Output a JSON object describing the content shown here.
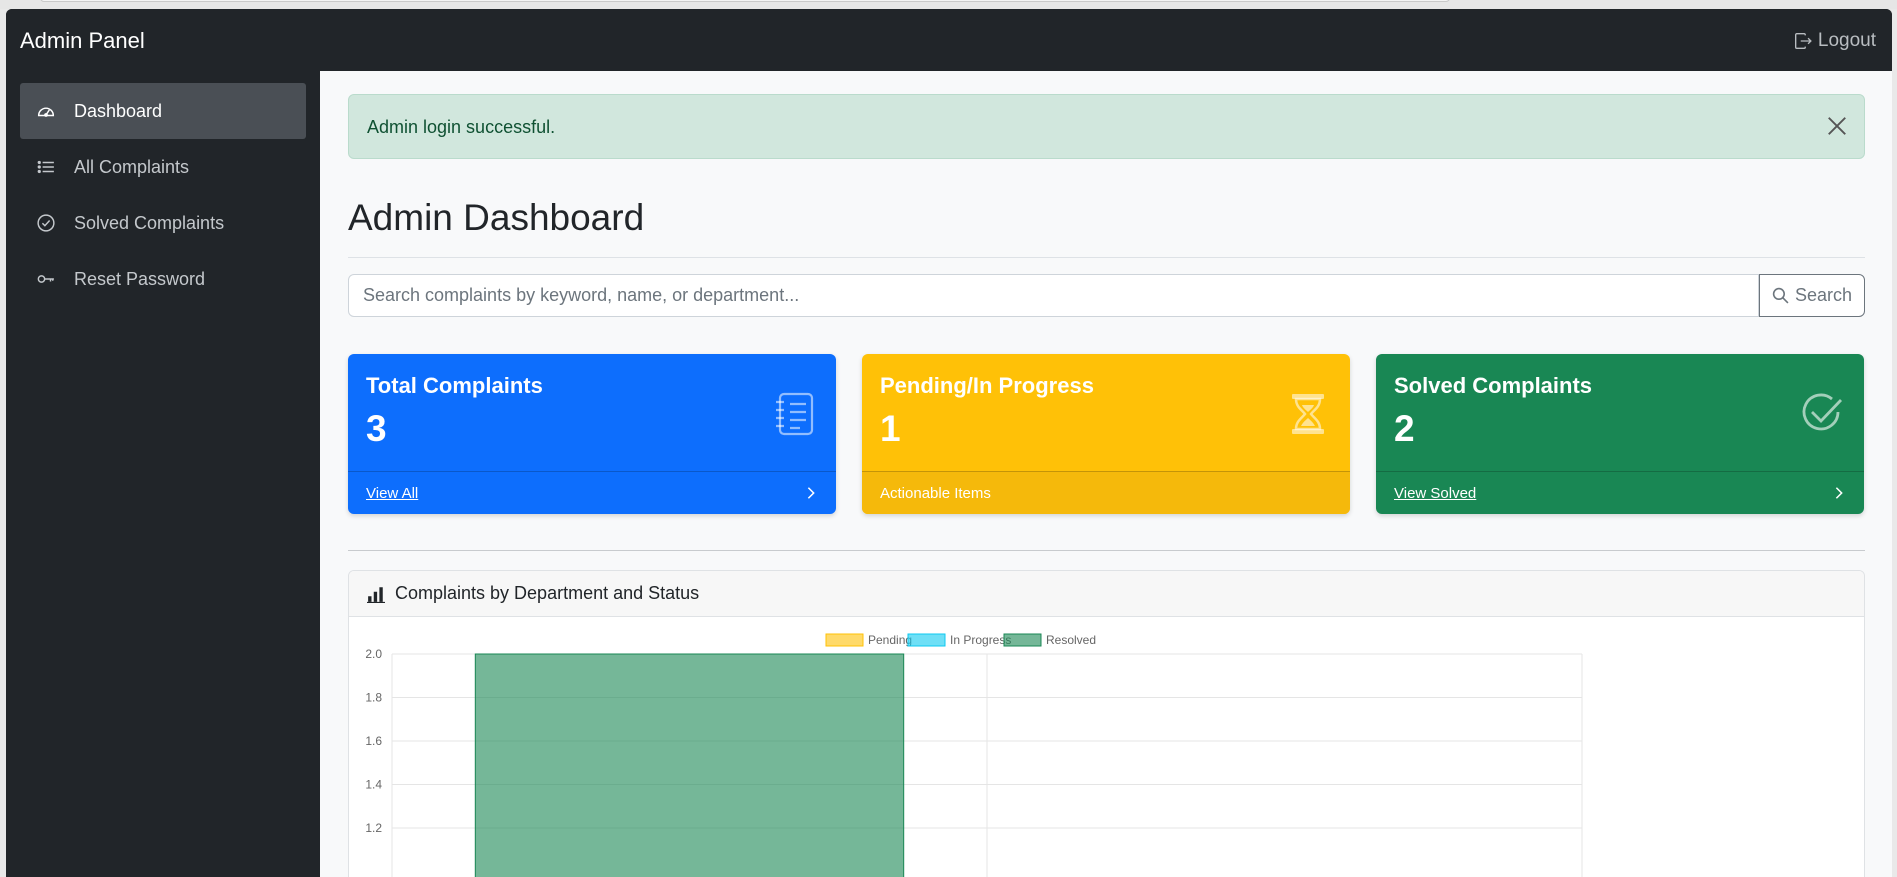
{
  "app": {
    "brand": "Admin Panel",
    "logout_label": "Logout"
  },
  "sidebar": {
    "items": [
      {
        "label": "Dashboard",
        "icon": "speedometer-icon",
        "active": true
      },
      {
        "label": "All Complaints",
        "icon": "list-icon",
        "active": false
      },
      {
        "label": "Solved Complaints",
        "icon": "check-circle-icon",
        "active": false
      },
      {
        "label": "Reset Password",
        "icon": "key-icon",
        "active": false
      }
    ]
  },
  "alert": {
    "message": "Admin login successful."
  },
  "page": {
    "title": "Admin Dashboard"
  },
  "search": {
    "placeholder": "Search complaints by keyword, name, or department...",
    "value": "",
    "button_label": "Search"
  },
  "cards": [
    {
      "title": "Total Complaints",
      "value": "3",
      "footer": "View All",
      "color": "#0d6efd",
      "icon": "journal-list-icon"
    },
    {
      "title": "Pending/In Progress",
      "value": "1",
      "footer": "Actionable Items",
      "color": "#ffc107",
      "icon": "hourglass-icon"
    },
    {
      "title": "Solved Complaints",
      "value": "2",
      "footer": "View Solved",
      "color": "#198754",
      "icon": "check-circle-icon"
    }
  ],
  "chart_panel": {
    "title": "Complaints by Department and Status",
    "icon": "bar-chart-icon"
  },
  "chart_data": {
    "type": "bar",
    "legend": [
      "Pending",
      "In Progress",
      "Resolved"
    ],
    "legend_position": "top",
    "series": [
      {
        "name": "Pending",
        "values": [
          0,
          0
        ],
        "color": "#ffc107"
      },
      {
        "name": "In Progress",
        "values": [
          0,
          0
        ],
        "color": "#0dcaf0"
      },
      {
        "name": "Resolved",
        "values": [
          2,
          0
        ],
        "color": "#198754"
      }
    ],
    "categories": [
      "",
      ""
    ],
    "y_ticks": [
      "2.0",
      "1.8",
      "1.6",
      "1.4",
      "1.2"
    ],
    "ylim": [
      1.2,
      2.0
    ],
    "grid": true
  }
}
